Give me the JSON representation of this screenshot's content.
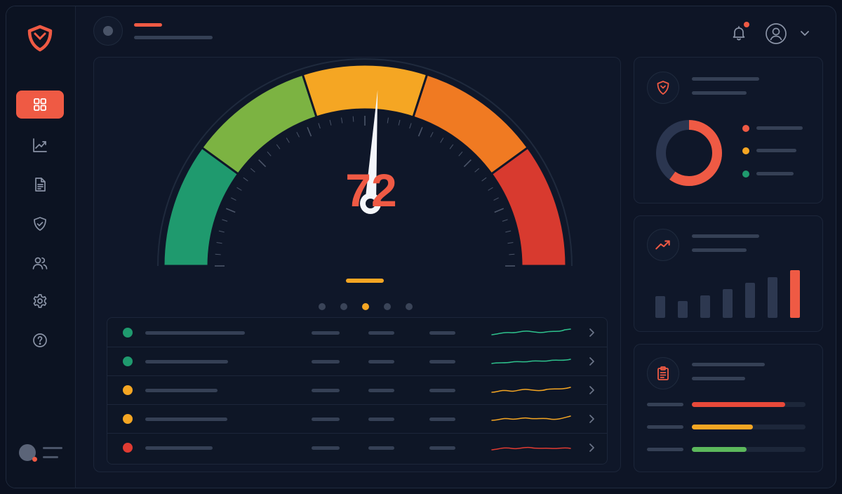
{
  "gauge": {
    "score": "72",
    "level": 0.52,
    "colors": [
      "#1f9a6e",
      "#7cb342",
      "#f5a623",
      "#f07a22",
      "#d83a2f"
    ]
  },
  "pager": {
    "count": 5,
    "active_index": 2
  },
  "risk_rows": [
    {
      "status_color": "#1f9a6e",
      "trend_color": "#2ec28d"
    },
    {
      "status_color": "#1f9a6e",
      "trend_color": "#2ec28d"
    },
    {
      "status_color": "#f5a623",
      "trend_color": "#f5a623"
    },
    {
      "status_color": "#f5a623",
      "trend_color": "#f5a623"
    },
    {
      "status_color": "#e03b32",
      "trend_color": "#e03b32"
    }
  ],
  "breakdown_card": {
    "icon": "shield-icon",
    "donut_colors": [
      "#ef5a44",
      "#f5a623",
      "#1f9a6e"
    ],
    "donut_share": 0.6
  },
  "trend_card": {
    "icon": "trending-up-icon",
    "bars": [
      0.45,
      0.35,
      0.47,
      0.6,
      0.73,
      0.85,
      1.0
    ],
    "bar_colors": [
      "#2d3850",
      "#ef5a44"
    ]
  },
  "report_card": {
    "icon": "clipboard-icon",
    "progress": [
      {
        "level": 0.82,
        "color": "#e8493a"
      },
      {
        "level": 0.54,
        "color": "#f5a623"
      },
      {
        "level": 0.48,
        "color": "#5cb85c"
      }
    ]
  },
  "sidebar": {
    "items": [
      "dashboard-icon",
      "analytics-icon",
      "document-icon",
      "shield-icon",
      "users-icon",
      "settings-icon",
      "help-icon"
    ],
    "active_index": 0
  },
  "colors": {
    "accent": "#ef5a44",
    "background": "#0e1526",
    "panel": "#0f1729"
  }
}
